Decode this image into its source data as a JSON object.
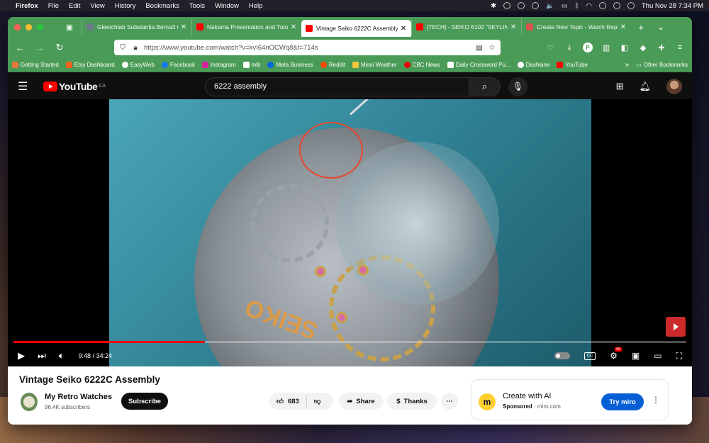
{
  "os_menubar": {
    "app_name": "Firefox",
    "menus": [
      "File",
      "Edit",
      "View",
      "History",
      "Bookmarks",
      "Tools",
      "Window",
      "Help"
    ],
    "clock": "Thu Nov 28  7:34 PM"
  },
  "tabs": [
    {
      "title": "Gleetchlab Substantia Berna3 C",
      "active": false,
      "favicon_color": "#6b7b8c"
    },
    {
      "title": "Nakama Presentation and Tutor",
      "active": false,
      "favicon_color": "#ff0000"
    },
    {
      "title": "Vintage Seiko 6222C Assembly",
      "active": true,
      "favicon_color": "#ff0000"
    },
    {
      "title": "[TECH] - SEIKO 6102 \"SKYLINE\"",
      "active": false,
      "favicon_color": "#ff0000"
    },
    {
      "title": "Create New Topic - Watch Repa",
      "active": false,
      "favicon_color": "#d9534f"
    }
  ],
  "toolbar": {
    "url": "https://www.youtube.com/watch?v=kvI64nOCWq8&t=714s",
    "ext_badge": "P"
  },
  "bookmarks": [
    {
      "label": "Getting Started",
      "color": "#e8773a"
    },
    {
      "label": "Etsy Dashboard",
      "color": "#f1641e"
    },
    {
      "label": "EasyWeb",
      "color": "#ffffff"
    },
    {
      "label": "Facebook",
      "color": "#1877f2"
    },
    {
      "label": "Instagram",
      "color": "#d6249f"
    },
    {
      "label": "mlb",
      "color": "#ffffff"
    },
    {
      "label": "Meta Business",
      "color": "#0668e1"
    },
    {
      "label": "Reddit",
      "color": "#ff4500"
    },
    {
      "label": "Missi Weather",
      "color": "#f5c542"
    },
    {
      "label": "CBC News",
      "color": "#e60505"
    },
    {
      "label": "Daily Crossword Pu...",
      "color": "#ffffff"
    },
    {
      "label": "Dashlane",
      "color": "#ffffff"
    },
    {
      "label": "YouTube",
      "color": "#ff0000"
    }
  ],
  "bookmarks_other": "Other Bookmarks",
  "youtube": {
    "logo_text": "YouTube",
    "country": "CA",
    "search_query": "6222 assembly"
  },
  "player": {
    "time_current": "9:48",
    "time_total": "34:24",
    "progress_fraction": 0.285,
    "hd_badge": "4K",
    "subscribe_watermark": "SUBSCRIBE"
  },
  "video": {
    "title": "Vintage Seiko 6222C Assembly",
    "channel_name": "My Retro Watches",
    "subscribers": "96.4K subscribers",
    "subscribe_label": "Subscribe",
    "likes": "683",
    "share_label": "Share",
    "thanks_label": "Thanks"
  },
  "ad": {
    "title": "Create with AI",
    "sponsored": "Sponsored",
    "domain": "miro.com",
    "cta": "Try miro",
    "brand_color": "#ffd02f"
  }
}
